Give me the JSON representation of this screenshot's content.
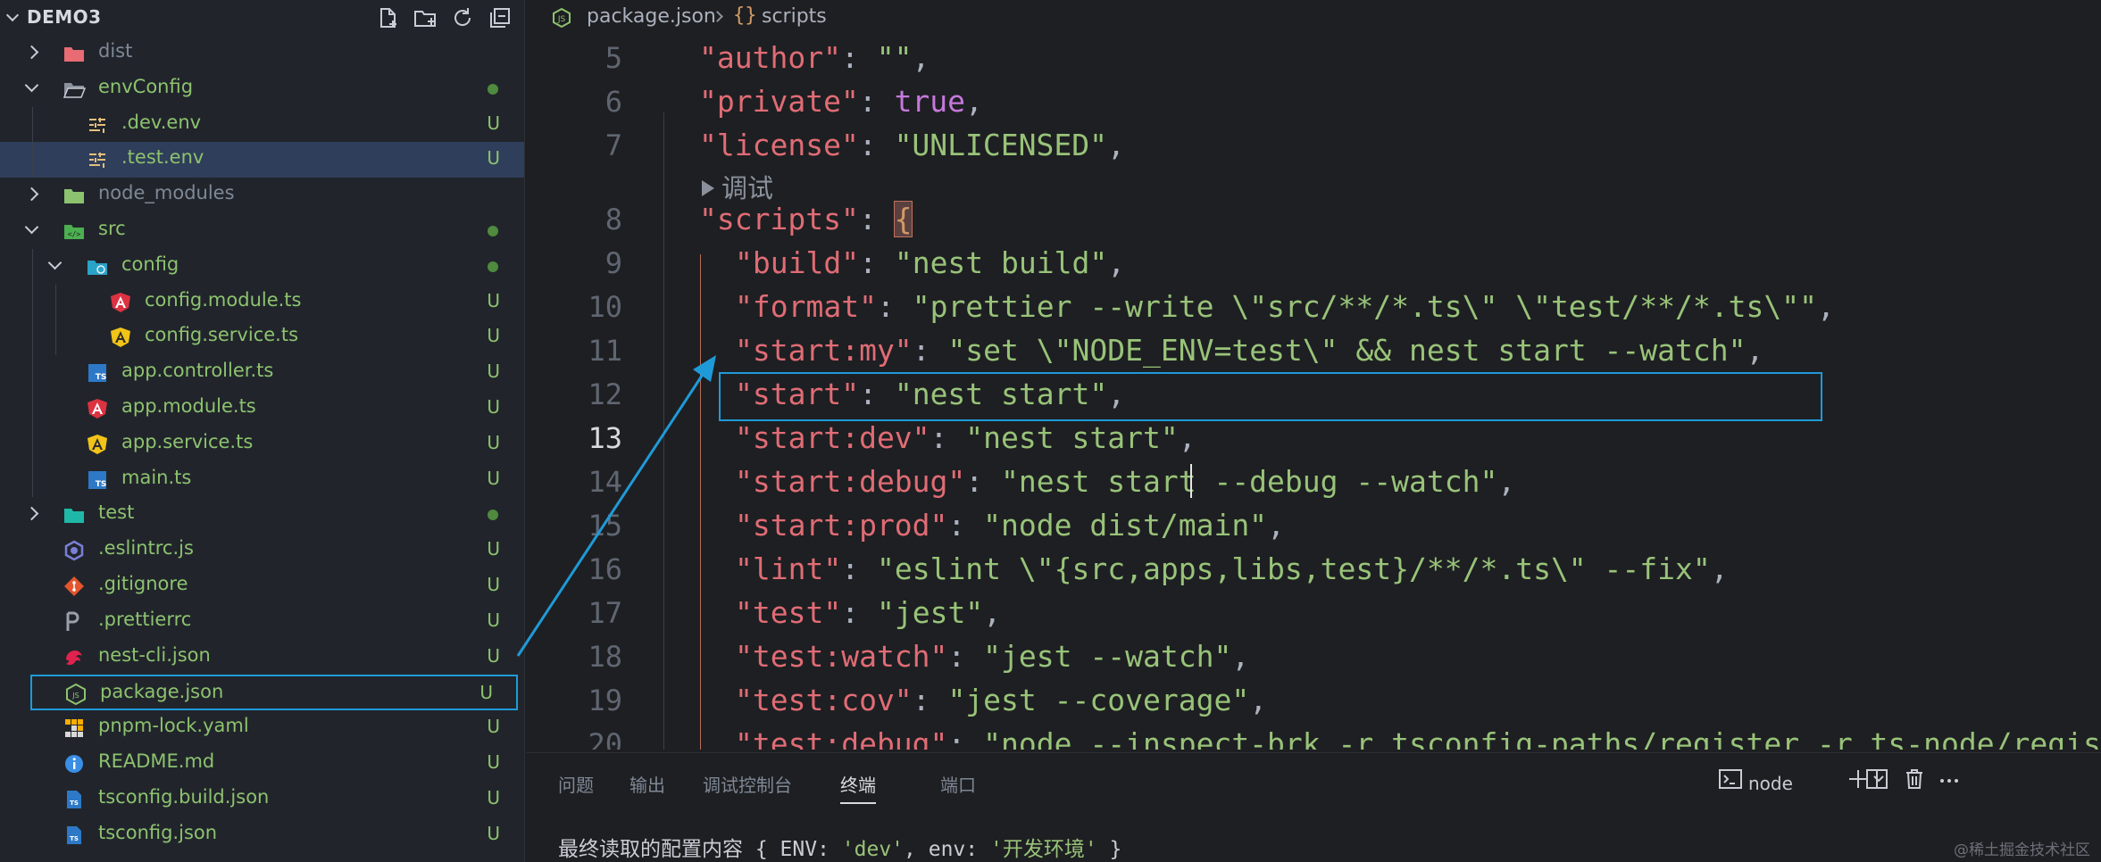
{
  "explorer": {
    "workspace": "DEMO3",
    "tree": [
      {
        "name": "dist",
        "kind": "folder",
        "expanded": false,
        "depth": 0,
        "color": "grey",
        "icon": "folder-dist-icon",
        "status": ""
      },
      {
        "name": "envConfig",
        "kind": "folder",
        "expanded": true,
        "depth": 0,
        "color": "green",
        "icon": "folder-open-icon",
        "status": "dot"
      },
      {
        "name": ".dev.env",
        "kind": "file",
        "depth": 1,
        "color": "green",
        "icon": "env-file-icon",
        "status": "U"
      },
      {
        "name": ".test.env",
        "kind": "file",
        "depth": 1,
        "color": "green",
        "icon": "env-file-icon",
        "status": "U",
        "selected": true
      },
      {
        "name": "node_modules",
        "kind": "folder",
        "expanded": false,
        "depth": 0,
        "color": "grey",
        "icon": "folder-node-icon",
        "status": ""
      },
      {
        "name": "src",
        "kind": "folder",
        "expanded": true,
        "depth": 0,
        "color": "green",
        "icon": "folder-src-icon",
        "status": "dot"
      },
      {
        "name": "config",
        "kind": "folder",
        "expanded": true,
        "depth": 1,
        "color": "green",
        "icon": "folder-config-icon",
        "status": "dot"
      },
      {
        "name": "config.module.ts",
        "kind": "file",
        "depth": 2,
        "color": "green",
        "icon": "angular-red-icon",
        "status": "U"
      },
      {
        "name": "config.service.ts",
        "kind": "file",
        "depth": 2,
        "color": "green",
        "icon": "angular-yellow-icon",
        "status": "U"
      },
      {
        "name": "app.controller.ts",
        "kind": "file",
        "depth": 1,
        "color": "green",
        "icon": "typescript-icon",
        "status": "U"
      },
      {
        "name": "app.module.ts",
        "kind": "file",
        "depth": 1,
        "color": "green",
        "icon": "angular-red-icon",
        "status": "U"
      },
      {
        "name": "app.service.ts",
        "kind": "file",
        "depth": 1,
        "color": "green",
        "icon": "angular-yellow-icon",
        "status": "U"
      },
      {
        "name": "main.ts",
        "kind": "file",
        "depth": 1,
        "color": "green",
        "icon": "typescript-icon",
        "status": "U"
      },
      {
        "name": "test",
        "kind": "folder",
        "expanded": false,
        "depth": 0,
        "color": "green",
        "icon": "folder-test-icon",
        "status": "dot"
      },
      {
        "name": ".eslintrc.js",
        "kind": "file",
        "depth": 0,
        "color": "green",
        "icon": "eslint-icon",
        "status": "U"
      },
      {
        "name": ".gitignore",
        "kind": "file",
        "depth": 0,
        "color": "green",
        "icon": "git-icon",
        "status": "U"
      },
      {
        "name": ".prettierrc",
        "kind": "file",
        "depth": 0,
        "color": "green",
        "icon": "prettier-icon",
        "status": "U"
      },
      {
        "name": "nest-cli.json",
        "kind": "file",
        "depth": 0,
        "color": "green",
        "icon": "nest-icon",
        "status": "U"
      },
      {
        "name": "package.json",
        "kind": "file",
        "depth": 0,
        "color": "green",
        "icon": "nodejs-icon",
        "status": "U",
        "focused": true
      },
      {
        "name": "pnpm-lock.yaml",
        "kind": "file",
        "depth": 0,
        "color": "green",
        "icon": "pnpm-icon",
        "status": "U"
      },
      {
        "name": "README.md",
        "kind": "file",
        "depth": 0,
        "color": "green",
        "icon": "info-icon",
        "status": "U"
      },
      {
        "name": "tsconfig.build.json",
        "kind": "file",
        "depth": 0,
        "color": "green",
        "icon": "tsconfig-icon",
        "status": "U"
      },
      {
        "name": "tsconfig.json",
        "kind": "file",
        "depth": 0,
        "color": "green",
        "icon": "tsconfig-icon",
        "status": "U"
      }
    ]
  },
  "breadcrumb": {
    "file": "package.json",
    "brace": "{}",
    "symbol": "scripts"
  },
  "editor": {
    "codelens": "调试",
    "active_line": 13,
    "lines": [
      {
        "n": "5",
        "indent": 1,
        "key": "\"author\"",
        "colon": ": ",
        "value": "\"\"",
        "vtype": "s",
        "tail": ","
      },
      {
        "n": "6",
        "indent": 1,
        "key": "\"private\"",
        "colon": ": ",
        "value": "true",
        "vtype": "b",
        "tail": ","
      },
      {
        "n": "7",
        "indent": 1,
        "key": "\"license\"",
        "colon": ": ",
        "value": "\"UNLICENSED\"",
        "vtype": "s",
        "tail": ","
      },
      {
        "n": "8",
        "indent": 1,
        "key": "\"scripts\"",
        "colon": ": ",
        "value": "{",
        "vtype": "brace",
        "tail": ""
      },
      {
        "n": "9",
        "indent": 2,
        "key": "\"build\"",
        "colon": ": ",
        "value": "\"nest build\"",
        "vtype": "s",
        "tail": ","
      },
      {
        "n": "10",
        "indent": 2,
        "key": "\"format\"",
        "colon": ": ",
        "value": "\"prettier --write \\\"src/**/*.ts\\\" \\\"test/**/*.ts\\\"\"",
        "vtype": "s",
        "tail": ","
      },
      {
        "n": "11",
        "indent": 2,
        "key": "\"start:my\"",
        "colon": ": ",
        "value": "\"set \\\"NODE_ENV=test\\\" && nest start --watch\"",
        "vtype": "s",
        "tail": ","
      },
      {
        "n": "12",
        "indent": 2,
        "key": "\"start\"",
        "colon": ": ",
        "value": "\"nest start\"",
        "vtype": "s",
        "tail": ","
      },
      {
        "n": "13",
        "indent": 2,
        "key": "\"start:dev\"",
        "colon": ": ",
        "value": "\"nest start\"",
        "vtype": "s",
        "tail": ","
      },
      {
        "n": "14",
        "indent": 2,
        "key": "\"start:debug\"",
        "colon": ": ",
        "value": "\"nest start --debug --watch\"",
        "vtype": "s",
        "tail": ","
      },
      {
        "n": "15",
        "indent": 2,
        "key": "\"start:prod\"",
        "colon": ": ",
        "value": "\"node dist/main\"",
        "vtype": "s",
        "tail": ","
      },
      {
        "n": "16",
        "indent": 2,
        "key": "\"lint\"",
        "colon": ": ",
        "value": "\"eslint \\\"{src,apps,libs,test}/**/*.ts\\\" --fix\"",
        "vtype": "s",
        "tail": ","
      },
      {
        "n": "17",
        "indent": 2,
        "key": "\"test\"",
        "colon": ": ",
        "value": "\"jest\"",
        "vtype": "s",
        "tail": ","
      },
      {
        "n": "18",
        "indent": 2,
        "key": "\"test:watch\"",
        "colon": ": ",
        "value": "\"jest --watch\"",
        "vtype": "s",
        "tail": ","
      },
      {
        "n": "19",
        "indent": 2,
        "key": "\"test:cov\"",
        "colon": ": ",
        "value": "\"jest --coverage\"",
        "vtype": "s",
        "tail": ","
      },
      {
        "n": "20",
        "indent": 2,
        "key": "\"test:debug\"",
        "colon": ": ",
        "value": "\"node --inspect-brk -r tsconfig-paths/register -r ts-node/regis",
        "vtype": "s",
        "tail": ""
      }
    ]
  },
  "panel": {
    "tabs": [
      "问题",
      "输出",
      "调试控制台",
      "终端",
      "端口"
    ],
    "active_tab": "终端",
    "terminal_name": "node",
    "terminal_output": {
      "prefix": "最终读取的配置内容 { ENV: ",
      "env_upper": "'dev'",
      "mid": ", env: ",
      "env_lower": "'开发环境'",
      "suffix": " }"
    },
    "watermark": "@稀土掘金技术社区"
  },
  "colors": {
    "accent": "#1f9ad8",
    "git_untracked": "#8dc26f",
    "selection": "#2f3e5a"
  }
}
